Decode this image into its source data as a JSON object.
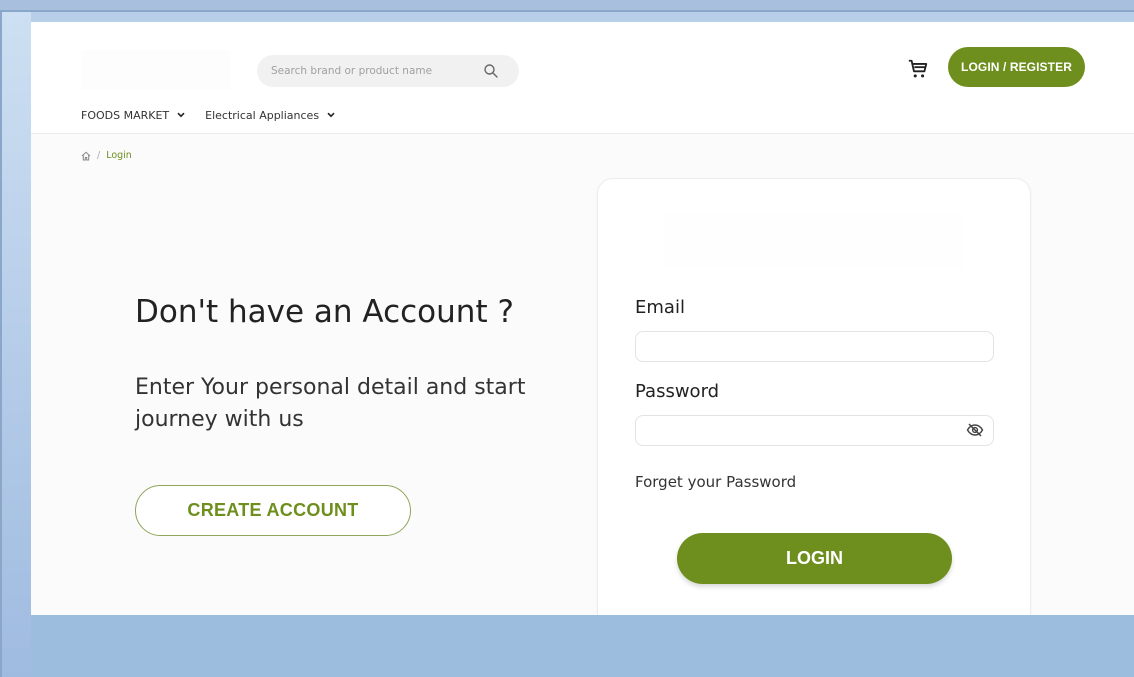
{
  "header": {
    "search": {
      "placeholder": "Search brand or product name"
    },
    "login_register_label": "LOGIN / REGISTER"
  },
  "nav": {
    "items": [
      {
        "label": "FOODS MARKET"
      },
      {
        "label": "Electrical Appliances"
      }
    ]
  },
  "breadcrumb": {
    "separator": "/",
    "current": "Login"
  },
  "left": {
    "title": "Don't have an Account ?",
    "subtitle": "Enter Your personal detail and start journey with us",
    "create_account_label": "CREATE ACCOUNT"
  },
  "login_form": {
    "email_label": "Email",
    "email_value": "",
    "password_label": "Password",
    "password_value": "",
    "forgot_label": "Forget your Password",
    "login_label": "LOGIN"
  },
  "colors": {
    "accent": "#6e8f1d",
    "outline": "#8ea55a"
  }
}
